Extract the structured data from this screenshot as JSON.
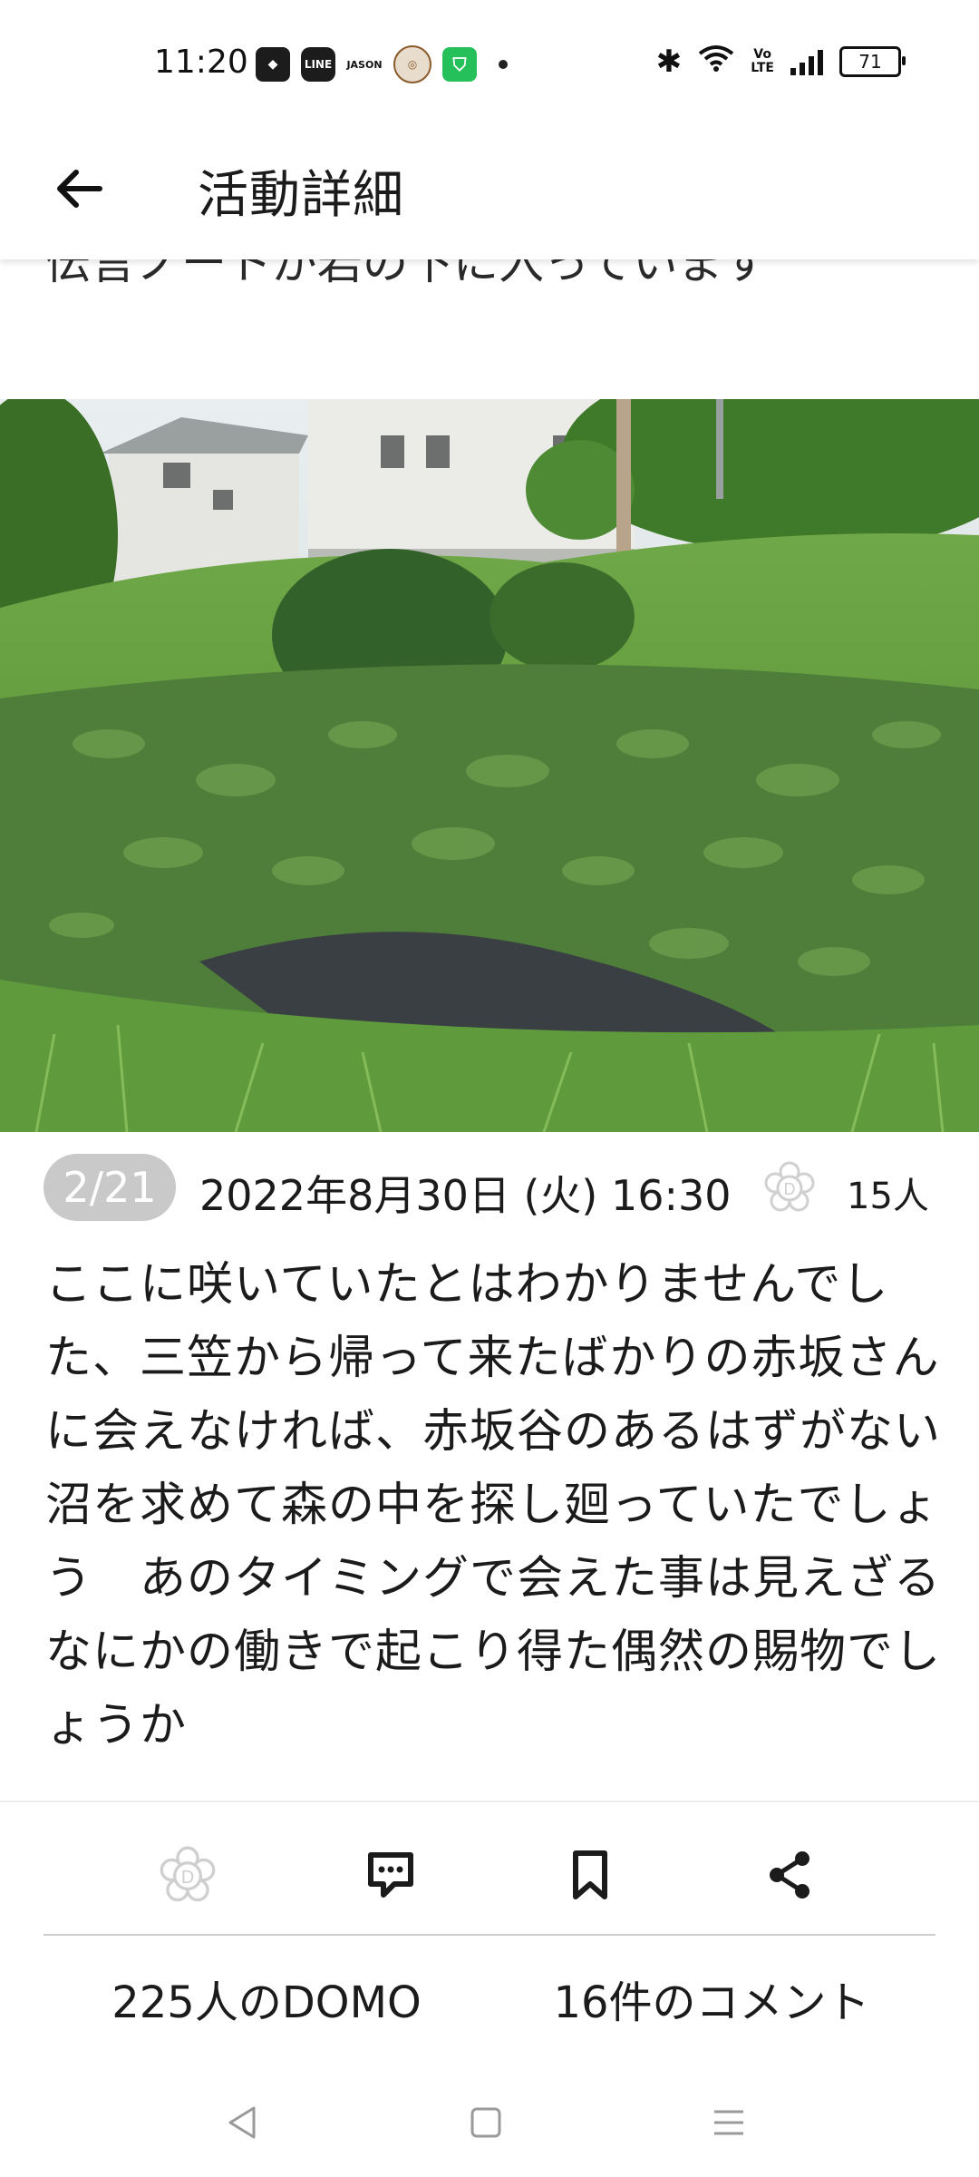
{
  "status_bar": {
    "time": "11:20",
    "battery": "71",
    "notification_labels": {
      "line": "LINE",
      "jason": "JASON"
    }
  },
  "header": {
    "title": "活動詳細"
  },
  "previous_text_fragment": "伝言ノートが岩の下に入っています",
  "post": {
    "page_indicator": "2/21",
    "datetime": "2022年8月30日 (火) 16:30",
    "domo_count_small": "15人",
    "body": "ここに咲いていたとはわかりませんでした、三笠から帰って来たばかりの赤坂さんに会えなければ、赤坂谷のあるはずがない沼を求めて森の中を探し廻っていたでしょう　あのタイミングで会えた事は見えざるなにかの働きで起こり得た偶然の賜物でしょうか"
  },
  "footer": {
    "domo_total": "225人のDOMO",
    "comment_total": "16件のコメント"
  },
  "colors": {
    "badge_bg": "#c9c9c9",
    "text": "#1b1b1b",
    "grass": "#5f9a3c",
    "water": "#3a3f44"
  }
}
